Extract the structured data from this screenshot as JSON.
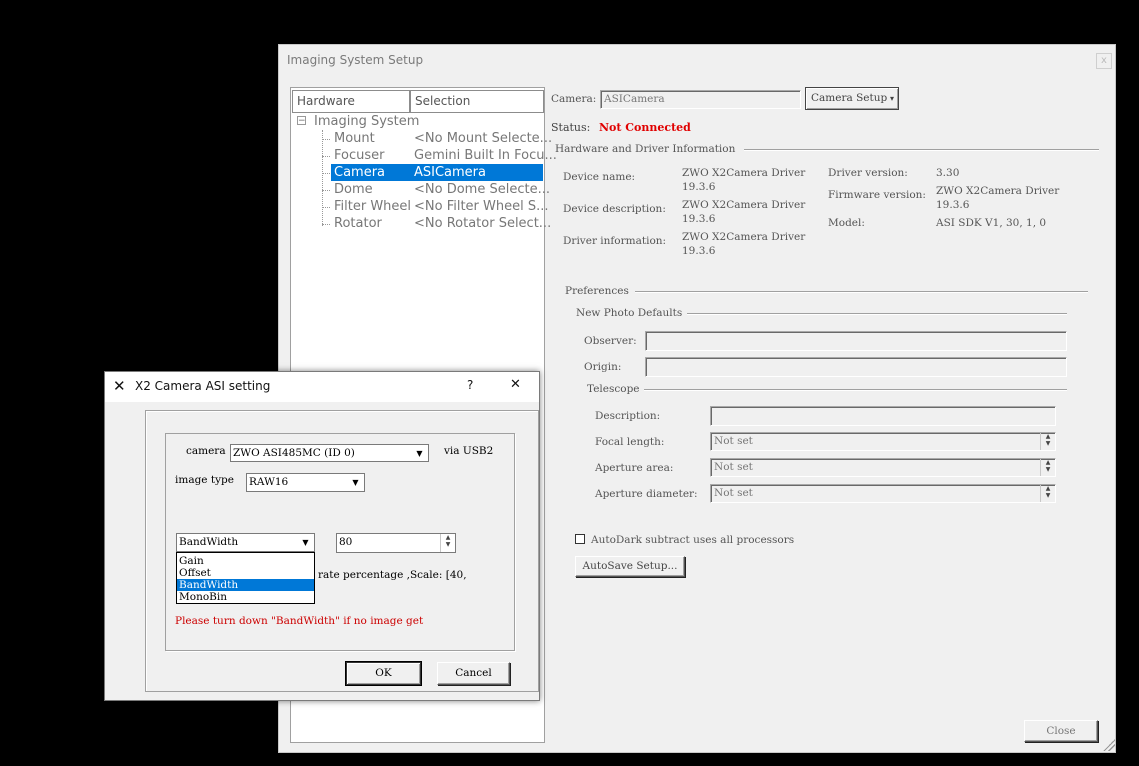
{
  "main_window": {
    "title": "Imaging System Setup",
    "close_glyph": "x",
    "tree": {
      "col_hardware": "Hardware",
      "col_selection": "Selection",
      "root": {
        "toggle": "−",
        "label": "Imaging System"
      },
      "items": [
        {
          "hardware": "Mount",
          "selection": "<No Mount Selecte..."
        },
        {
          "hardware": "Focuser",
          "selection": "Gemini Built In Focu..."
        },
        {
          "hardware": "Camera",
          "selection": "ASICamera"
        },
        {
          "hardware": "Dome",
          "selection": "<No Dome Selecte..."
        },
        {
          "hardware": "Filter Wheel",
          "selection": "<No Filter Wheel S..."
        },
        {
          "hardware": "Rotator",
          "selection": "<No Rotator Select..."
        }
      ]
    },
    "camera_label": "Camera:",
    "camera_value": "ASICamera",
    "camera_setup_button": "Camera Setup",
    "status_label": "Status:",
    "status_value": "Not Connected",
    "hw_info_group": "Hardware and Driver Information",
    "device_name_label": "Device name:",
    "device_name_value": [
      "ZWO X2Camera Driver",
      "19.3.6"
    ],
    "device_desc_label": "Device description:",
    "device_desc_value": [
      "ZWO X2Camera Driver",
      "19.3.6"
    ],
    "driver_info_label": "Driver information:",
    "driver_info_value": [
      "ZWO X2Camera Driver",
      "19.3.6"
    ],
    "driver_version_label": "Driver version:",
    "driver_version_value": "3.30",
    "firmware_version_label": "Firmware version:",
    "firmware_version_value": [
      "ZWO X2Camera Driver",
      "19.3.6"
    ],
    "model_label": "Model:",
    "model_value": "ASI SDK V1, 30, 1, 0",
    "preferences_group": "Preferences",
    "new_photo_defaults_group": "New Photo Defaults",
    "observer_label": "Observer:",
    "observer_value": "",
    "origin_label": "Origin:",
    "origin_value": "",
    "telescope_group": "Telescope",
    "description_label": "Description:",
    "description_value": "",
    "focal_length_label": "Focal length:",
    "focal_length_value": "Not set",
    "aperture_area_label": "Aperture area:",
    "aperture_area_value": "Not set",
    "aperture_diameter_label": "Aperture diameter:",
    "aperture_diameter_value": "Not set",
    "autodark_checked": false,
    "autodark_label": "AutoDark subtract uses all processors",
    "autosave_button": "AutoSave Setup...",
    "close_button": "Close"
  },
  "dialog": {
    "title": "X2 Camera ASI setting",
    "help_glyph": "?",
    "close_glyph": "✕",
    "camera_label": "camera",
    "camera_value": "ZWO ASI485MC (ID 0)",
    "via_label": "via USB2",
    "image_type_label": "image type",
    "image_type_value": "RAW16",
    "control_value": "BandWidth",
    "control_options": [
      "Gain",
      "Offset",
      "BandWidth",
      "MonoBin"
    ],
    "control_selected_index": 2,
    "control_number": "80",
    "description_text": "rate percentage ,Scale: [40,",
    "warning_text": "Please turn down \"BandWidth\" if no image get",
    "ok_button": "OK",
    "cancel_button": "Cancel"
  },
  "colors": {
    "selection_blue": "#0078d7",
    "status_red": "#e00000",
    "warning_red": "#cc0000"
  }
}
